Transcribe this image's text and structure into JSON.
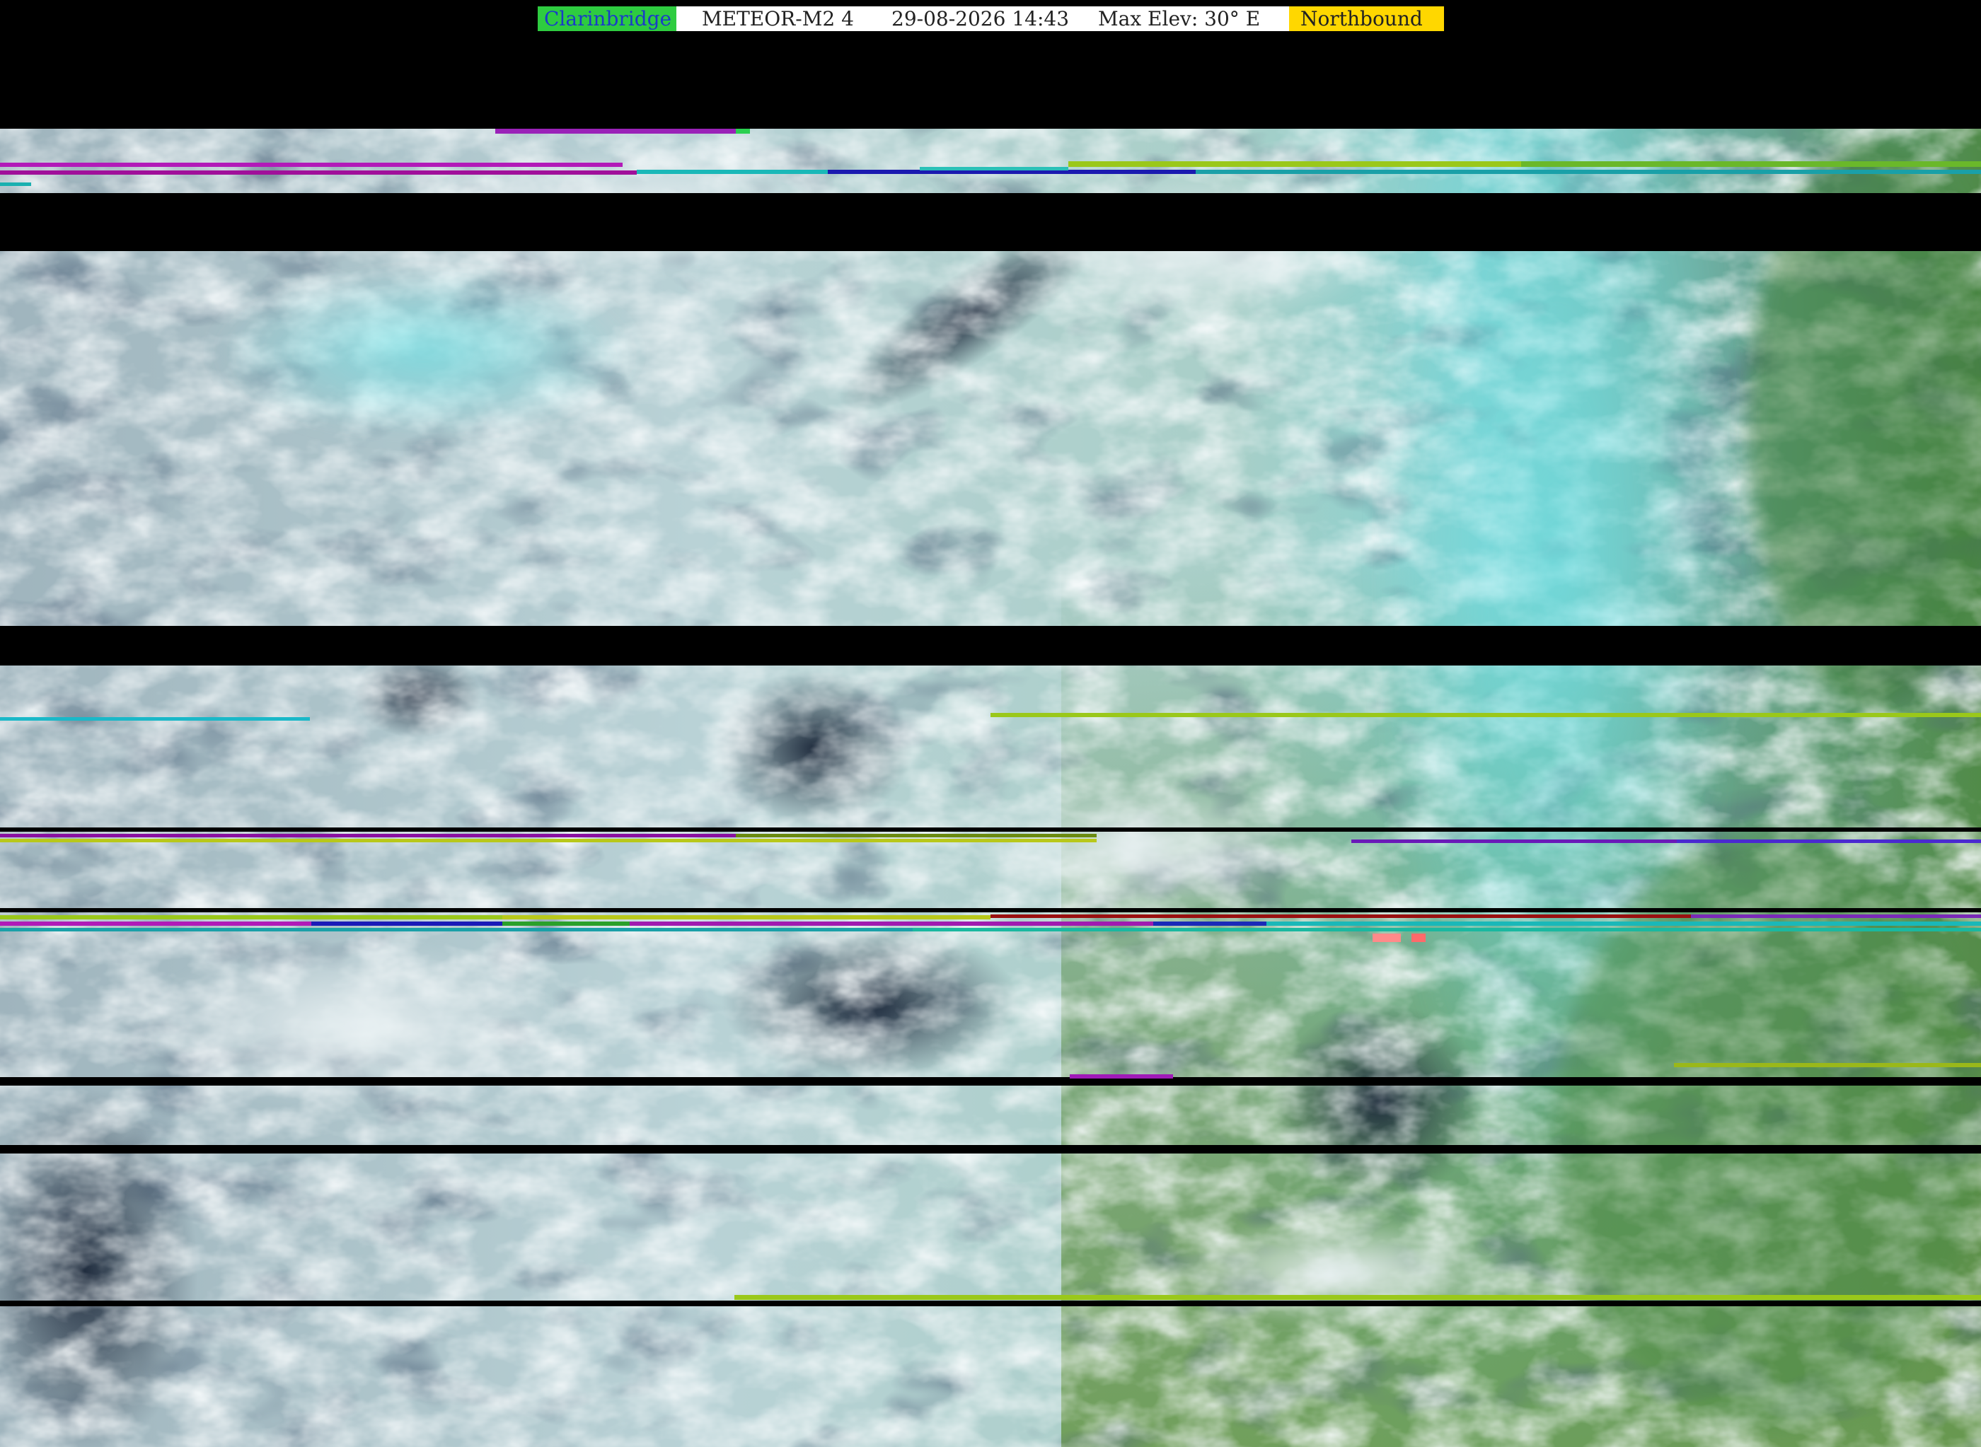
{
  "header": {
    "station": "Clarinbridge",
    "satellite": "METEOR-M2 4",
    "datetime": "29-08-2026 14:43",
    "max_elevation": "Max Elev: 30° E",
    "direction": "Northbound"
  },
  "colors": {
    "station_bg": "#2ecc40",
    "station_text": "#1a3cc8",
    "caption_bg": "#ffffff",
    "direction_bg": "#ffd700",
    "background": "#000000"
  }
}
